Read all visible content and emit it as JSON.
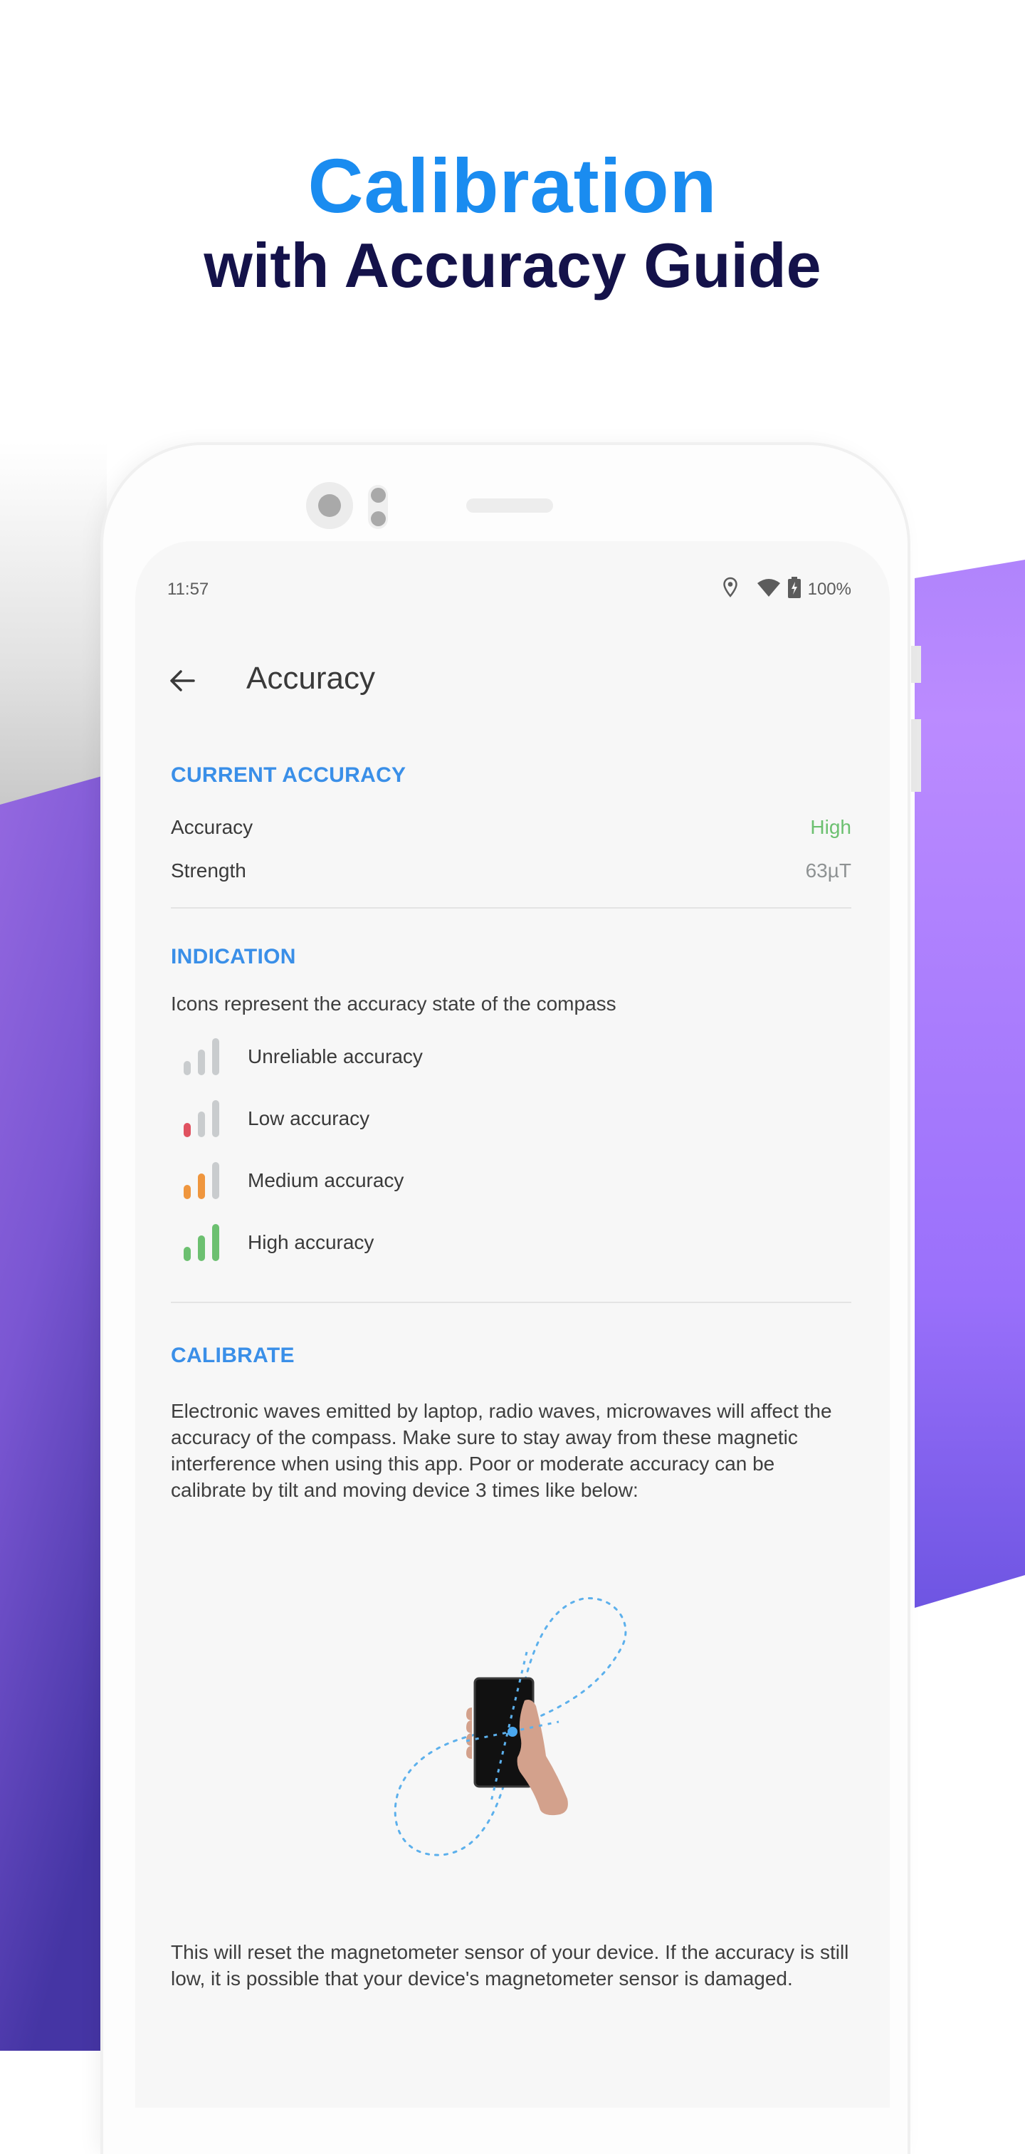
{
  "headline": {
    "line1": "Calibration",
    "line2": "with Accuracy Guide"
  },
  "colors": {
    "headline_blue": "#1a8cf0",
    "headline_navy": "#14124a",
    "section_blue": "#3a8fe8",
    "accuracy_high_green": "#6cc070",
    "bar_inactive": "#c9ccce",
    "bar_low_red": "#e05260",
    "bar_medium_orange": "#ef963e",
    "bar_high_green": "#6cc070",
    "purple_light": "#b98bff",
    "purple_dark": "#4a38b0"
  },
  "status_bar": {
    "time": "11:57",
    "icons": [
      "location-icon",
      "wifi-icon",
      "battery-charging-icon"
    ],
    "battery_percent": "100%"
  },
  "toolbar": {
    "back_icon": "arrow-left-icon",
    "title": "Accuracy"
  },
  "current_accuracy": {
    "title": "CURRENT ACCURACY",
    "rows": [
      {
        "label": "Accuracy",
        "value": "High"
      },
      {
        "label": "Strength",
        "value": "63µT"
      }
    ]
  },
  "indication": {
    "title": "INDICATION",
    "description": "Icons represent the accuracy state of the compass",
    "items": [
      {
        "label": "Unreliable accuracy",
        "level": 0,
        "level_max": 3
      },
      {
        "label": "Low accuracy",
        "level": 1,
        "level_max": 3
      },
      {
        "label": "Medium accuracy",
        "level": 2,
        "level_max": 3
      },
      {
        "label": "High accuracy",
        "level": 3,
        "level_max": 3
      }
    ]
  },
  "calibrate": {
    "title": "CALIBRATE",
    "description": "Electronic waves emitted by laptop, radio waves, microwaves will affect the accuracy of the compass. Make sure to stay away from these magnetic interference when using this app. Poor or moderate accuracy can be calibrate by tilt and moving device 3 times like below:",
    "illustration": "phone-figure-eight-calibration-illustration",
    "footer_text": "This will reset the magnetometer sensor of your device. If the accuracy is still low, it is possible that your device's magnetometer sensor is damaged."
  }
}
